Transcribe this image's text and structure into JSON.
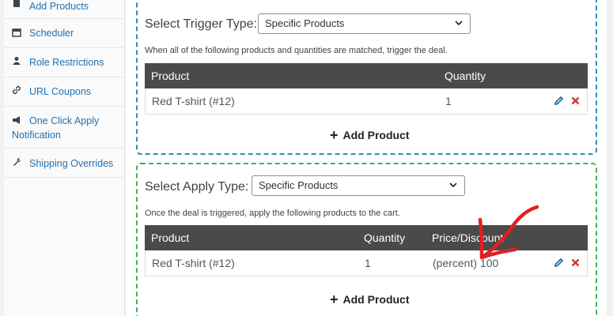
{
  "sidebar": {
    "items": [
      {
        "label": "Add Products",
        "icon": "clipboard-icon"
      },
      {
        "label": "Scheduler",
        "icon": "calendar-icon"
      },
      {
        "label": "Role Restrictions",
        "icon": "user-icon"
      },
      {
        "label": "URL Coupons",
        "icon": "link-icon"
      },
      {
        "label": "One Click Apply",
        "label2": "Notification",
        "icon": "megaphone-icon"
      },
      {
        "label": "Shipping Overrides",
        "icon": "wrench-icon"
      }
    ]
  },
  "trigger": {
    "select_label": "Select Trigger Type:",
    "select_value": "Specific Products",
    "description": "When all of the following products and quantities are matched, trigger the deal.",
    "columns": [
      "Product",
      "Quantity"
    ],
    "rows": [
      {
        "product": "Red T-shirt (#12)",
        "quantity": "1"
      }
    ],
    "add_label": "Add Product"
  },
  "apply": {
    "select_label": "Select Apply Type:",
    "select_value": "Specific Products",
    "description": "Once the deal is triggered, apply the following products to the cart.",
    "columns": [
      "Product",
      "Quantity",
      "Price/Discount"
    ],
    "rows": [
      {
        "product": "Red T-shirt (#12)",
        "quantity": "1",
        "price": "(percent) 100"
      }
    ],
    "add_label": "Add Product"
  },
  "colors": {
    "trigger_border": "#2e8fb3",
    "apply_border": "#3cb35a",
    "table_header": "#4a4a4a",
    "edit_icon": "#2271b1",
    "delete_icon": "#d63638",
    "annotation_arrow": "#e02020"
  }
}
